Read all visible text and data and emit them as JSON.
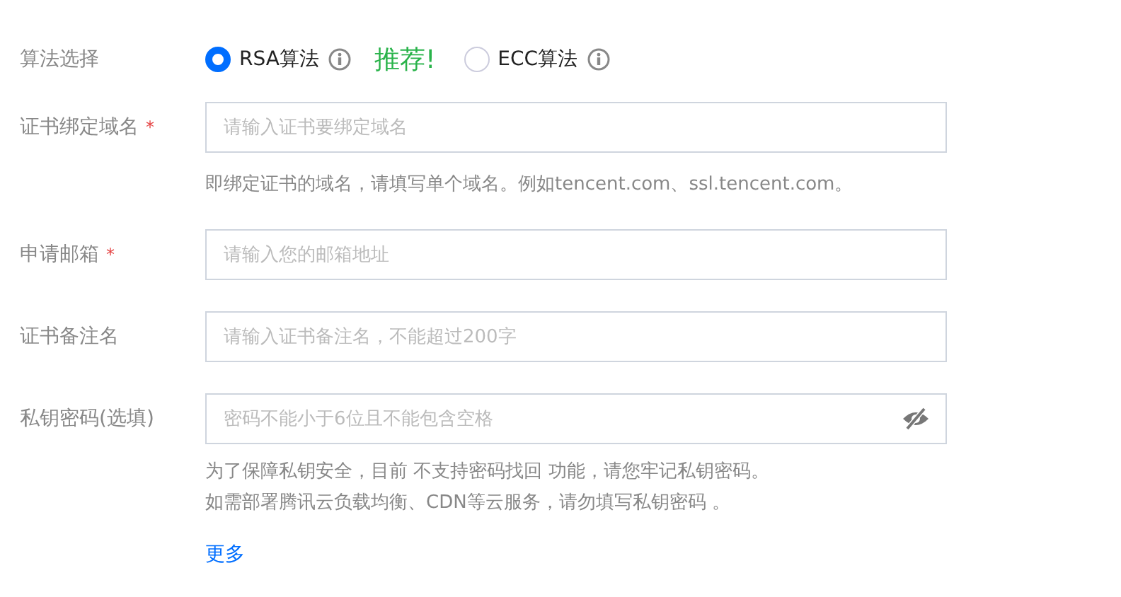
{
  "algorithm": {
    "label": "算法选择",
    "options": [
      {
        "label": "RSA算法",
        "selected": true,
        "note": "推荐!"
      },
      {
        "label": "ECC算法",
        "selected": false
      }
    ]
  },
  "fields": [
    {
      "kind": "text",
      "label": "证书绑定域名",
      "required_mark": "*",
      "placeholder": "请输入证书要绑定域名",
      "help": [
        "即绑定证书的域名，请填写单个域名。例如tencent.com、ssl.tencent.com。"
      ]
    },
    {
      "kind": "text",
      "label": "申请邮箱",
      "required_mark": "*",
      "placeholder": "请输入您的邮箱地址"
    },
    {
      "kind": "text",
      "label": "证书备注名",
      "placeholder": "请输入证书备注名，不能超过200字"
    },
    {
      "kind": "password",
      "label": "私钥密码(选填)",
      "placeholder": "密码不能小于6位且不能包含空格",
      "help": [
        "为了保障私钥安全，目前 不支持密码找回 功能，请您牢记私钥密码。",
        "如需部署腾讯云负载均衡、CDN等云服务，请勿填写私钥密码 。"
      ]
    }
  ],
  "more_link": "更多"
}
